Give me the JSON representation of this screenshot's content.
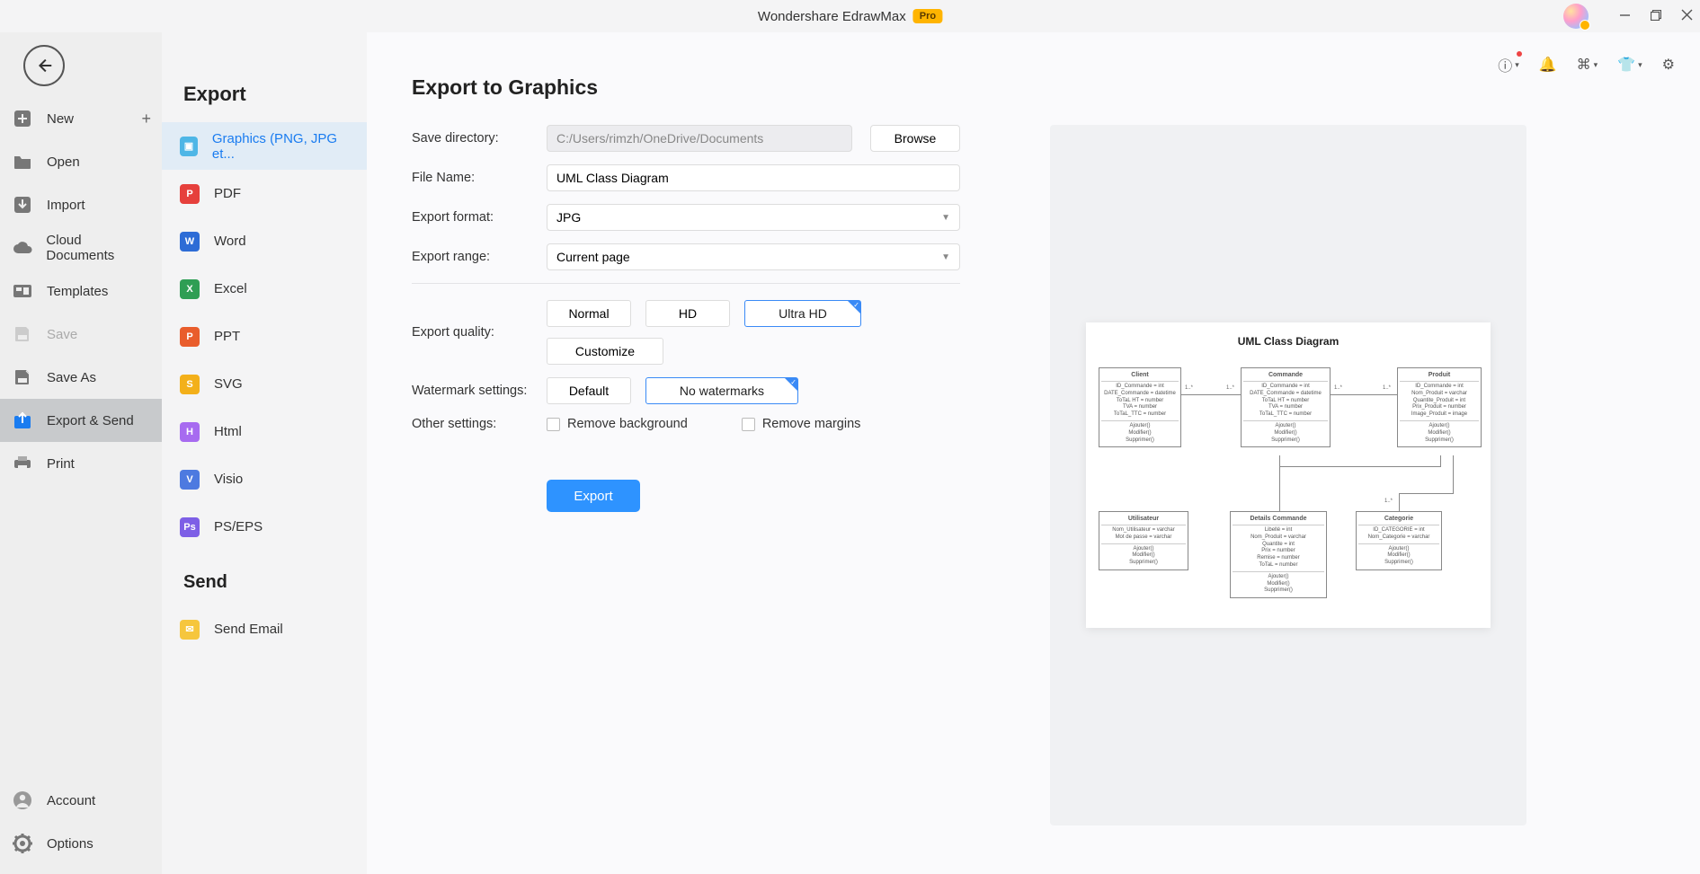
{
  "titlebar": {
    "app_title": "Wondershare EdrawMax",
    "badge": "Pro"
  },
  "rail": {
    "items": [
      {
        "label": "New",
        "icon": "plus-square-icon",
        "has_add": true
      },
      {
        "label": "Open",
        "icon": "folder-icon"
      },
      {
        "label": "Import",
        "icon": "import-icon"
      },
      {
        "label": "Cloud Documents",
        "icon": "cloud-icon"
      },
      {
        "label": "Templates",
        "icon": "templates-icon"
      },
      {
        "label": "Save",
        "icon": "save-icon",
        "disabled": true
      },
      {
        "label": "Save As",
        "icon": "save-as-icon"
      },
      {
        "label": "Export & Send",
        "icon": "export-icon",
        "selected": true
      },
      {
        "label": "Print",
        "icon": "print-icon"
      }
    ],
    "bottom": [
      {
        "label": "Account",
        "icon": "account-icon"
      },
      {
        "label": "Options",
        "icon": "gear-icon"
      }
    ]
  },
  "col2": {
    "title": "Export",
    "formats": [
      {
        "label": "Graphics (PNG, JPG et...",
        "color": "#4eb6e6",
        "selected": true
      },
      {
        "label": "PDF",
        "color": "#e6403c"
      },
      {
        "label": "Word",
        "color": "#2d6cd6"
      },
      {
        "label": "Excel",
        "color": "#2f9e54"
      },
      {
        "label": "PPT",
        "color": "#e95d2c"
      },
      {
        "label": "SVG",
        "color": "#f3b01a"
      },
      {
        "label": "Html",
        "color": "#a76bf0"
      },
      {
        "label": "Visio",
        "color": "#4d7ae0"
      },
      {
        "label": "PS/EPS",
        "color": "#7d5fe6"
      }
    ],
    "send_title": "Send",
    "send_items": [
      {
        "label": "Send Email",
        "color": "#f6c63d"
      }
    ]
  },
  "form": {
    "page_title": "Export to Graphics",
    "labels": {
      "save_dir": "Save directory:",
      "file_name": "File Name:",
      "export_format": "Export format:",
      "export_range": "Export range:",
      "export_quality": "Export quality:",
      "watermark": "Watermark settings:",
      "other": "Other settings:"
    },
    "values": {
      "save_dir": "C:/Users/rimzh/OneDrive/Documents",
      "file_name": "UML Class Diagram",
      "export_format": "JPG",
      "export_range": "Current page"
    },
    "browse": "Browse",
    "quality": {
      "normal": "Normal",
      "hd": "HD",
      "ultra": "Ultra HD",
      "customize": "Customize"
    },
    "watermark_opts": {
      "default": "Default",
      "none": "No watermarks"
    },
    "other_opts": {
      "remove_bg": "Remove background",
      "remove_margins": "Remove margins"
    },
    "export_btn": "Export"
  },
  "preview": {
    "title": "UML Class Diagram",
    "boxes": {
      "client": {
        "name": "Client",
        "attrs": "ID_Commande = int\nDATE_Commande = datetime\nToTaL HT = number\nTVA = number\nToTaL_TTC = number",
        "ops": "Ajouter()\nModifier()\nSupprimer()"
      },
      "commande": {
        "name": "Commande",
        "attrs": "ID_Commande = int\nDATE_Commande = datetime\nToTaL HT = number\nTVA = number\nToTaL_TTC = number",
        "ops": "Ajouter()\nModifier()\nSupprimer()"
      },
      "produit": {
        "name": "Produit",
        "attrs": "ID_Commande = int\nNom_Produit = varchar\nQuantite_Produit = int\nPrix_Produit = number\nImage_Produit = image",
        "ops": "Ajouter()\nModifier()\nSupprimer()"
      },
      "utilisateur": {
        "name": "Utilisateur",
        "attrs": "Nom_Utilisateur = varchar\nMot de passe = varchar",
        "ops": "Ajouter()\nModifier()\nSupprimer()"
      },
      "details": {
        "name": "Details Commande",
        "attrs": "Libellé = int\nNom_Produit = varchar\nQuantite = int\nPrix = number\nRemise = number\nToTaL = number",
        "ops": "Ajouter()\nModifier()\nSupprimer()"
      },
      "categorie": {
        "name": "Categorie",
        "attrs": "ID_CATEGORIE = int\nNom_Categorie = varchar",
        "ops": "Ajouter()\nModifier()\nSupprimer()"
      }
    },
    "cardinalities": {
      "c1": "1..*",
      "c2": "1..*",
      "c3": "1..*",
      "c4": "1..*"
    }
  }
}
